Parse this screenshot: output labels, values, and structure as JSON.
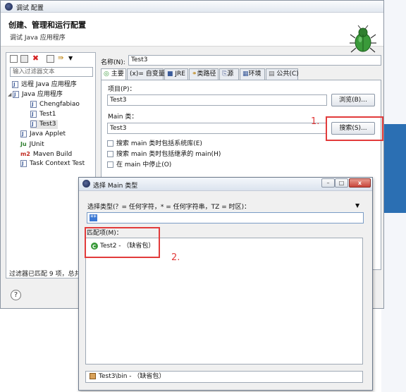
{
  "main_window": {
    "title": "调试 配置",
    "header_title": "创建、管理和运行配置",
    "header_subtitle": "调试 Java 应用程序",
    "filter_placeholder": "输入过滤器文本",
    "tree": [
      {
        "label": "远程 Java 应用程序",
        "icon": "remote-java-icon",
        "level": 0
      },
      {
        "label": "Java 应用程序",
        "icon": "java-app-icon",
        "level": 0,
        "expanded": true
      },
      {
        "label": "Chengfabiao",
        "icon": "java-class-icon",
        "level": 1
      },
      {
        "label": "Test1",
        "icon": "java-class-icon",
        "level": 1
      },
      {
        "label": "Test3",
        "icon": "java-class-icon",
        "level": 1,
        "selected": true
      },
      {
        "label": "Java Applet",
        "icon": "java-applet-icon",
        "level": 0
      },
      {
        "label": "JUnit",
        "icon": "junit-icon",
        "level": 0
      },
      {
        "label": "Maven Build",
        "icon": "maven-icon",
        "level": 0
      },
      {
        "label": "Task Context Test",
        "icon": "task-context-icon",
        "level": 0
      }
    ],
    "filter_status": "过滤器已匹配 9 项，总共",
    "help_label": "?",
    "name_label": "名称(N):",
    "name_value": "Test3",
    "tabs": [
      "主要",
      "(x)= 自变量",
      "JRE",
      "类路径",
      "源",
      "环境",
      "公共(C)"
    ],
    "project_label": "项目(P)：",
    "project_value": "Test3",
    "browse_button": "浏览(B)...",
    "main_class_label": "Main 类：",
    "main_class_value": "Test3",
    "search_button": "搜索(S)...",
    "checkboxes": [
      "搜索 main 类时包括系统库(E)",
      "搜索 main 类时包括继承的 main(H)",
      "在 main 中停止(O)"
    ],
    "annotation_1": "1."
  },
  "dialog": {
    "title": "选择 Main 类型",
    "minimize": "–",
    "maximize": "□",
    "close": "x",
    "type_label": "选择类型(？= 任何字符，* = 任何字符串，TZ = 时区)：",
    "type_value": "**",
    "menu_arrow": "▼",
    "matches_label": "匹配项(M)：",
    "matches": [
      "Test2 - （缺省包）"
    ],
    "status": "Test3\\bin - （缺省包）",
    "annotation_2": "2."
  },
  "colors": {
    "annotation_red": "#e23b3b",
    "selection_blue": "#3a78d4",
    "background_blue": "#2b6fb3"
  }
}
